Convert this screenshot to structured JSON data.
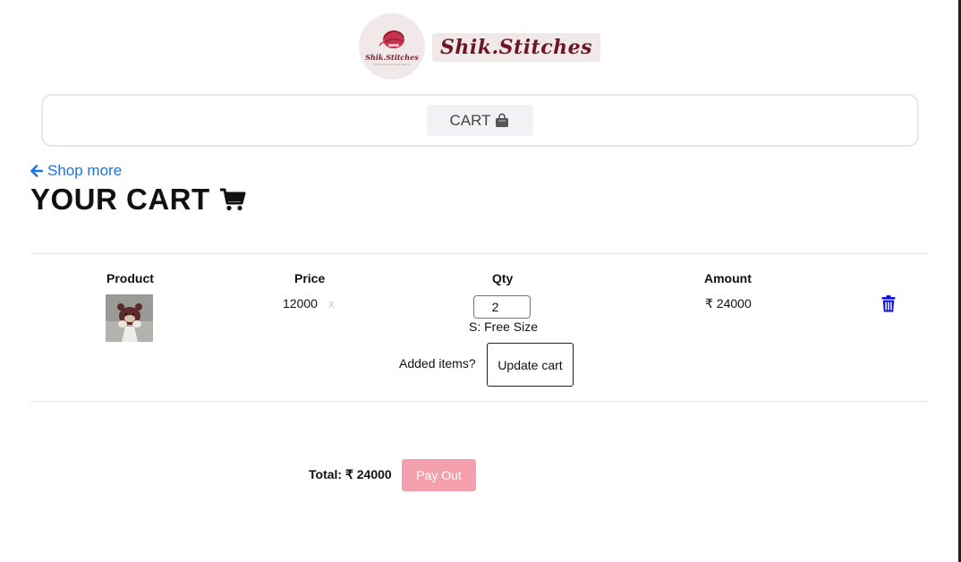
{
  "header": {
    "logo_text": "Shik.Stitches",
    "logo_subtext": "HANDMADE CROCHETS",
    "brand_name": "Shik.Stitches",
    "accent_color": "#6e1626"
  },
  "nav": {
    "cart_label": "CART",
    "cart_icon": "shopping-bag-icon"
  },
  "shop_more": {
    "label": "Shop more",
    "icon": "arrow-left-icon",
    "color": "#1a73e8"
  },
  "page_title": {
    "text": "YOUR CART",
    "icon": "shopping-cart-icon"
  },
  "table": {
    "headers": {
      "product": "Product",
      "price": "Price",
      "qty": "Qty",
      "amount": "Amount"
    },
    "rows": [
      {
        "product_image": "crochet-bear-keychain",
        "price": "12000",
        "times": "x",
        "qty": "2",
        "size": "S: Free Size",
        "amount": "₹ 24000",
        "delete_icon": "trash-icon"
      }
    ],
    "added_items_label": "Added items?",
    "update_label": "Update cart"
  },
  "footer": {
    "total_label": "Total: ₹ 24000",
    "payout_label": "Pay Out",
    "payout_color": "#f4a0ac"
  }
}
